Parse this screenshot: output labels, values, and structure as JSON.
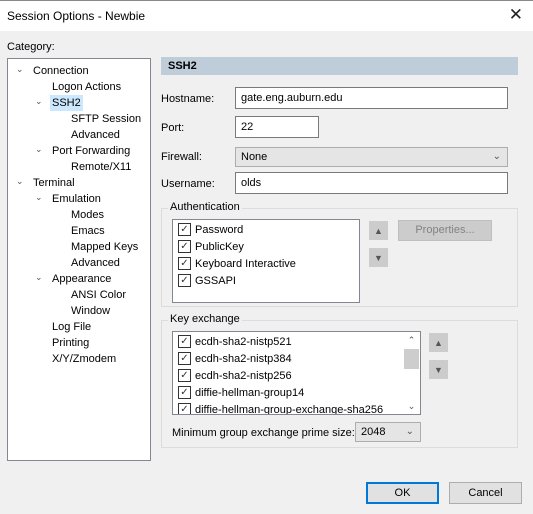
{
  "window": {
    "title": "Session Options - Newbie",
    "close_icon": "close-icon"
  },
  "category_label": "Category:",
  "tree": [
    {
      "label": "Connection",
      "level": 0,
      "expanded": true
    },
    {
      "label": "Logon Actions",
      "level": 1,
      "expanded": null
    },
    {
      "label": "SSH2",
      "level": 1,
      "expanded": true,
      "selected": true
    },
    {
      "label": "SFTP Session",
      "level": 2,
      "expanded": null
    },
    {
      "label": "Advanced",
      "level": 2,
      "expanded": null
    },
    {
      "label": "Port Forwarding",
      "level": 1,
      "expanded": true
    },
    {
      "label": "Remote/X11",
      "level": 2,
      "expanded": null
    },
    {
      "label": "Terminal",
      "level": 0,
      "expanded": true
    },
    {
      "label": "Emulation",
      "level": 1,
      "expanded": true
    },
    {
      "label": "Modes",
      "level": 2,
      "expanded": null
    },
    {
      "label": "Emacs",
      "level": 2,
      "expanded": null
    },
    {
      "label": "Mapped Keys",
      "level": 2,
      "expanded": null
    },
    {
      "label": "Advanced",
      "level": 2,
      "expanded": null
    },
    {
      "label": "Appearance",
      "level": 1,
      "expanded": true
    },
    {
      "label": "ANSI Color",
      "level": 2,
      "expanded": null
    },
    {
      "label": "Window",
      "level": 2,
      "expanded": null
    },
    {
      "label": "Log File",
      "level": 1,
      "expanded": null
    },
    {
      "label": "Printing",
      "level": 1,
      "expanded": null
    },
    {
      "label": "X/Y/Zmodem",
      "level": 1,
      "expanded": null
    }
  ],
  "panel": {
    "header": "SSH2",
    "hostname_label": "Hostname:",
    "hostname_value": "gate.eng.auburn.edu",
    "port_label": "Port:",
    "port_value": "22",
    "firewall_label": "Firewall:",
    "firewall_value": "None",
    "username_label": "Username:",
    "username_value": "olds"
  },
  "authentication": {
    "label": "Authentication",
    "items": [
      {
        "label": "Password",
        "checked": true
      },
      {
        "label": "PublicKey",
        "checked": true
      },
      {
        "label": "Keyboard Interactive",
        "checked": true
      },
      {
        "label": "GSSAPI",
        "checked": true
      }
    ],
    "properties_label": "Properties..."
  },
  "key_exchange": {
    "label": "Key exchange",
    "items": [
      {
        "label": "ecdh-sha2-nistp521",
        "checked": true
      },
      {
        "label": "ecdh-sha2-nistp384",
        "checked": true
      },
      {
        "label": "ecdh-sha2-nistp256",
        "checked": true
      },
      {
        "label": "diffie-hellman-group14",
        "checked": true
      },
      {
        "label": "diffie-hellman-group-exchange-sha256",
        "checked": true
      }
    ],
    "min_prime_label": "Minimum group exchange prime size:",
    "min_prime_value": "2048"
  },
  "buttons": {
    "ok": "OK",
    "cancel": "Cancel"
  },
  "glyphs": {
    "check": "✓",
    "chevron": "⌄",
    "up": "▲",
    "down": "▼",
    "scroll_up": "⌃",
    "close": "✕"
  }
}
